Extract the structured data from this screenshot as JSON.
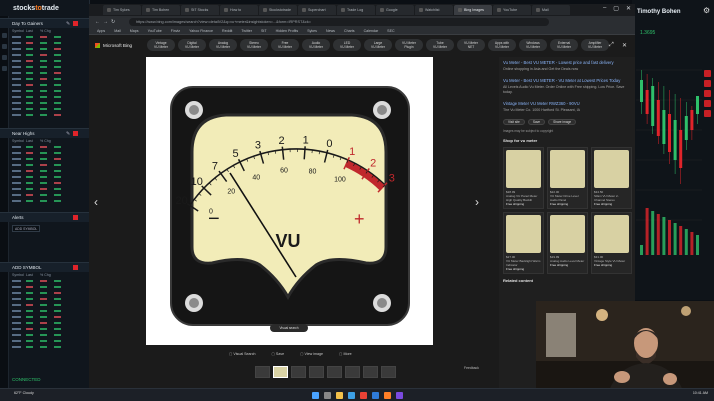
{
  "left": {
    "brand_a": "stocks",
    "brand_b": "to",
    "brand_c": "trade",
    "p1_title": "Day To Gainers",
    "p1_cols": [
      "Symbol",
      "Last",
      "% Chg"
    ],
    "p2_title": "Near Highs",
    "p2_cols": [
      "Symbol",
      "Last",
      "% Chg"
    ],
    "p3_title": "Alerts",
    "p3_input": "ADD SYMBOL",
    "p4_input": "ADD SYMBOL",
    "p4_cols": [
      "Symbol",
      "Last",
      "% Chg"
    ],
    "status": "CONNECTED"
  },
  "right": {
    "user": "Timothy Bohen",
    "price": "1.3695"
  },
  "browser": {
    "tabs": [
      "Tim Sykes",
      "Tim Bohen",
      "StT Stocks",
      "How to",
      "Stockstotrade",
      "Superchart",
      "Trade Log",
      "Google",
      "Watchlist",
      "Bing Images",
      "YouTube",
      "Mail"
    ],
    "url": "https://www.bing.com/images/search?view=detailV2&q=vu+meter&insightstoken=...&form=IRPRST&ck=",
    "bookmarks": [
      "Apps",
      "Mail",
      "Maps",
      "YouTube",
      "Finviz",
      "Yahoo Finance",
      "Reddit",
      "Twitter",
      "StT",
      "Hidden Profits",
      "Sykes",
      "News",
      "Charts",
      "Calendar",
      "SEC"
    ]
  },
  "bing": {
    "logo": "Microsoft Bing",
    "chips": [
      {
        "a": "Vintage",
        "b": "VU Meter"
      },
      {
        "a": "Digital",
        "b": "VU Meter"
      },
      {
        "a": "Analog",
        "b": "VU Meter"
      },
      {
        "a": "Stereo",
        "b": "VU Meter"
      },
      {
        "a": "Free",
        "b": "VU Meter"
      },
      {
        "a": "Audio",
        "b": "VU Meter"
      },
      {
        "a": "LED",
        "b": "VU Meter"
      },
      {
        "a": "Large",
        "b": "VU Meter"
      },
      {
        "a": "VU Meter",
        "b": "Plugin"
      },
      {
        "a": "Tube",
        "b": "VU Meter"
      },
      {
        "a": "VU Meter",
        "b": "NET"
      },
      {
        "a": "Apps with",
        "b": "VU Meter"
      },
      {
        "a": "Windows",
        "b": "VU Meter"
      },
      {
        "a": "External",
        "b": "VU Meter"
      },
      {
        "a": "Amplifier",
        "b": "VU Meter"
      }
    ],
    "meter": {
      "label": "VU",
      "scale": [
        "20",
        "10",
        "7",
        "5",
        "3",
        "2",
        "1",
        "0",
        "1",
        "2",
        "3"
      ],
      "pct": [
        "0",
        "20",
        "40",
        "60",
        "80",
        "100"
      ],
      "minus": "−",
      "plus": "+"
    },
    "visual_search": "Visual search",
    "actions": [
      "Visual Search",
      "Save",
      "View image",
      "More"
    ],
    "feedback": "Feedback",
    "results": [
      {
        "title": "Vu Meter - Best VU METER - Lowest price and fast delivery",
        "desc": "Online shopping in Asia and Get the Deals now"
      },
      {
        "title": "Vu Meter - Best VU METER - VU Meter at Lowest Prices Today",
        "desc": "All Levels Audio Vu Meter. Order Online with Free shipping. Low Price. Save today."
      },
      {
        "title": "Vintage Meter VU Meter RWZ360 - 90VU",
        "desc": "The Vu Meter Co. 1000 Hartford St. Pleasant, IA"
      }
    ],
    "result_pills": [
      "Visit site",
      "Save",
      "Share image"
    ],
    "legal": "Images may be subject to copyright",
    "shop_title": "Shop for vu meter",
    "cards": [
      {
        "price": "$28.99",
        "title": "Analog VU Panel Meter High Quality Backlit",
        "ship": "Free shipping"
      },
      {
        "price": "$22.00",
        "title": "VU Meter Drive Level Audio Panel",
        "ship": "Free shipping"
      },
      {
        "price": "$34.50",
        "title": "Sifam VU Meter 2-Channel Stereo",
        "ship": "Free shipping"
      },
      {
        "price": "$27.00",
        "title": "VU Meter Backlight Warm Indicator",
        "ship": "Free shipping"
      },
      {
        "price": "$19.99",
        "title": "Analog Audio Level Meter",
        "ship": "Free shipping"
      },
      {
        "price": "$31.00",
        "title": "Vintage Style VU Meter",
        "ship": "Free shipping"
      }
    ],
    "related_title": "Related content"
  },
  "taskbar": {
    "weather": "62°F  Cloudy",
    "clock": "10:41 AM"
  },
  "colors": {
    "meter_face": "#f2ecb8",
    "meter_red": "#c0282c",
    "accent_orange": "#ff7f27",
    "green": "#2ec06a"
  }
}
